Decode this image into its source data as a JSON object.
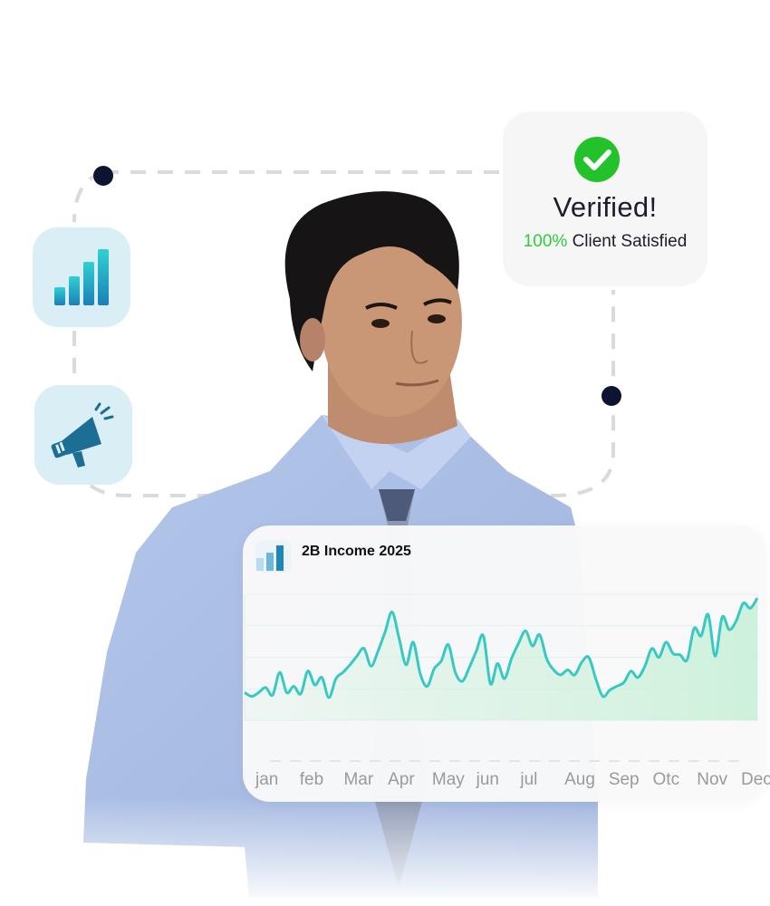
{
  "verified": {
    "title": "Verified!",
    "percent": "100%",
    "subtitle": "Client Satisfied",
    "accent_color": "#2ecc40",
    "icon": "check-circle-icon"
  },
  "tiles": [
    {
      "icon": "bar-chart-icon"
    },
    {
      "icon": "megaphone-icon"
    }
  ],
  "income_card": {
    "title": "2B Income 2025",
    "icon": "bar-chart-icon"
  },
  "chart_data": {
    "type": "area",
    "title": "2B Income 2025",
    "categories": [
      "jan",
      "feb",
      "Mar",
      "Apr",
      "May",
      "jun",
      "jul",
      "Aug",
      "Sep",
      "Otc",
      "Nov",
      "Dec"
    ],
    "ylim": [
      0,
      100
    ],
    "grid": true,
    "line_color": "#38c9c4",
    "fill_color": "#c9f0d8",
    "values": [
      22,
      19,
      22,
      26,
      20,
      38,
      22,
      27,
      21,
      39,
      28,
      34,
      18,
      33,
      38,
      44,
      51,
      57,
      43,
      55,
      70,
      86,
      65,
      44,
      62,
      37,
      27,
      41,
      47,
      60,
      38,
      31,
      42,
      55,
      67,
      29,
      45,
      33,
      49,
      61,
      71,
      59,
      68,
      49,
      40,
      36,
      40,
      36,
      46,
      50,
      33,
      19,
      24,
      27,
      30,
      39,
      34,
      43,
      57,
      50,
      62,
      53,
      52,
      48,
      73,
      67,
      84,
      51,
      82,
      72,
      79,
      93,
      89,
      97
    ]
  }
}
